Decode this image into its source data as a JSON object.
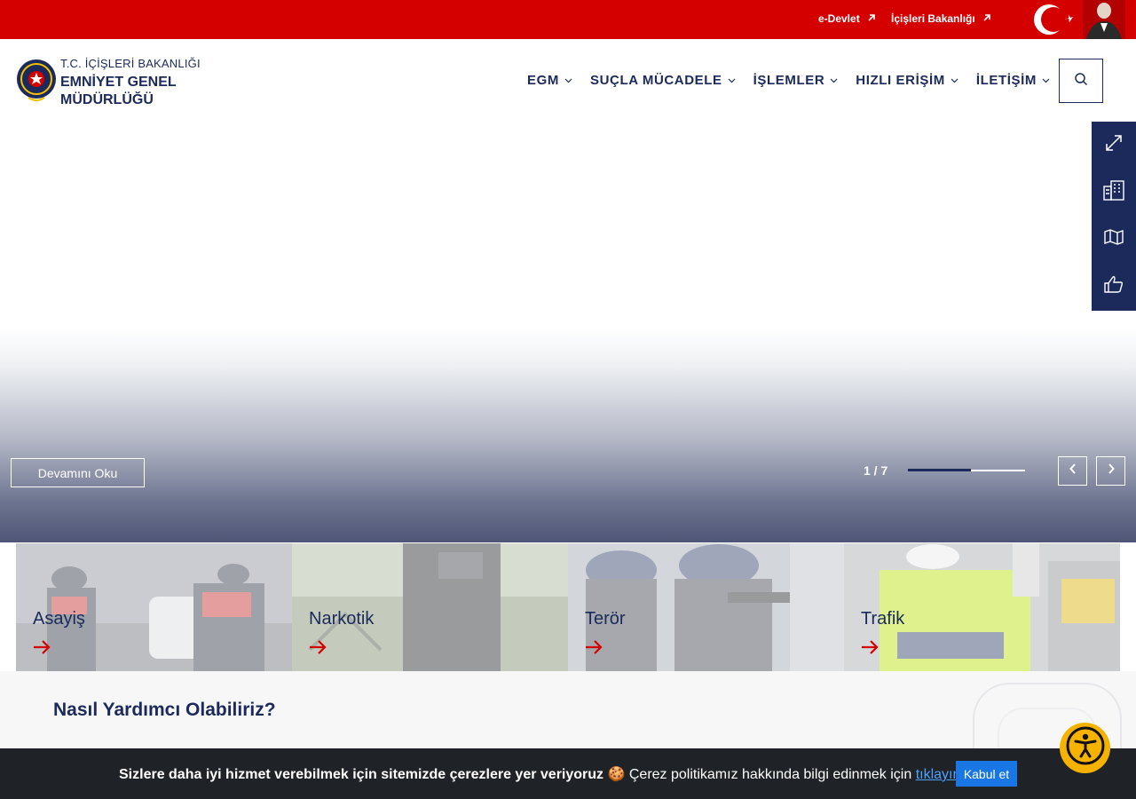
{
  "topbar": {
    "links": [
      {
        "label": "e-Devlet",
        "icon": "external-arrow-icon"
      },
      {
        "label": "İçişleri Bakanlığı",
        "icon": "external-arrow-icon"
      }
    ],
    "flag_icon": "turkish-flag-ataturk-icon",
    "color": "#d40000"
  },
  "header": {
    "logo_icon": "police-badge-icon",
    "ministry": "T.C. İÇİŞLERİ BAKANLIĞI",
    "org_line1": "EMNİYET GENEL",
    "org_line2": "MÜDÜRLÜĞÜ",
    "nav": [
      {
        "label": "EGM"
      },
      {
        "label": "SUÇLA MÜCADELE"
      },
      {
        "label": "İŞLEMLER"
      },
      {
        "label": "HIZLI ERİŞİM"
      },
      {
        "label": "İLETİŞİM"
      }
    ],
    "search_icon": "search-icon",
    "brand_color": "#1b2a5a"
  },
  "hero": {
    "read_more": "Devamını Oku",
    "page_current": "1",
    "page_total": "7",
    "page_label": "1 / 7",
    "progress_fraction": 0.54,
    "prev_icon": "chevron-left-icon",
    "next_icon": "chevron-right-icon"
  },
  "side_tools": [
    {
      "icon": "expand-icon"
    },
    {
      "icon": "building-icon"
    },
    {
      "icon": "map-icon"
    },
    {
      "icon": "thumbs-up-icon"
    }
  ],
  "cards": [
    {
      "label": "Asayiş",
      "icon": "arrow-right-icon"
    },
    {
      "label": "Narkotik",
      "icon": "arrow-right-icon"
    },
    {
      "label": "Terör",
      "icon": "arrow-right-icon"
    },
    {
      "label": "Trafik",
      "icon": "arrow-right-icon"
    }
  ],
  "help": {
    "title": "Nasıl Yardımcı Olabiliriz?"
  },
  "cookie": {
    "bold_text": "Sizlere daha iyi hizmet verebilmek için sitemizde çerezlere yer veriyoruz",
    "emoji": "🍪",
    "text": "Çerez politikamız hakkında bilgi edinmek için",
    "link": "tıklayınız",
    "accept": "Kabul et"
  },
  "accessibility": {
    "icon": "accessibility-icon",
    "color": "#f5b300"
  }
}
